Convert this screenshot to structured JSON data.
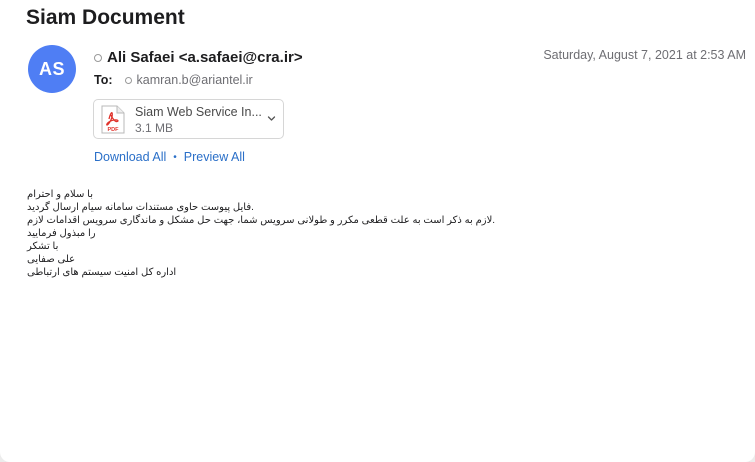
{
  "subject": "Siam Document",
  "sender": {
    "initials": "AS",
    "display": "Ali Safaei <a.safaei@cra.ir>",
    "avatar_color": "#4f7ef4"
  },
  "date": "Saturday, August 7, 2021 at 2:53 AM",
  "to": {
    "label": "To:",
    "address": "kamran.b@ariantel.ir"
  },
  "attachment": {
    "name": "Siam Web Service In...",
    "size": "3.1 MB",
    "icon": "pdf-icon",
    "icon_text": "PDF"
  },
  "links": {
    "download_all": "Download All",
    "separator": "•",
    "preview_all": "Preview All"
  },
  "body_lines": [
    "با سلام و احترام",
    ".فایل پیوست حاوی مستندات سامانه سیام ارسال گردید",
    ".لازم به ذکر است به علت قطعی مکرر و طولانی سرویس شما، جهت حل مشکل و ماندگاری سرویس اقدامات لازم را مبذول فرمایید",
    "با تشکر",
    "علی صفایی",
    "اداره کل امنیت سیستم های ارتباطی"
  ]
}
